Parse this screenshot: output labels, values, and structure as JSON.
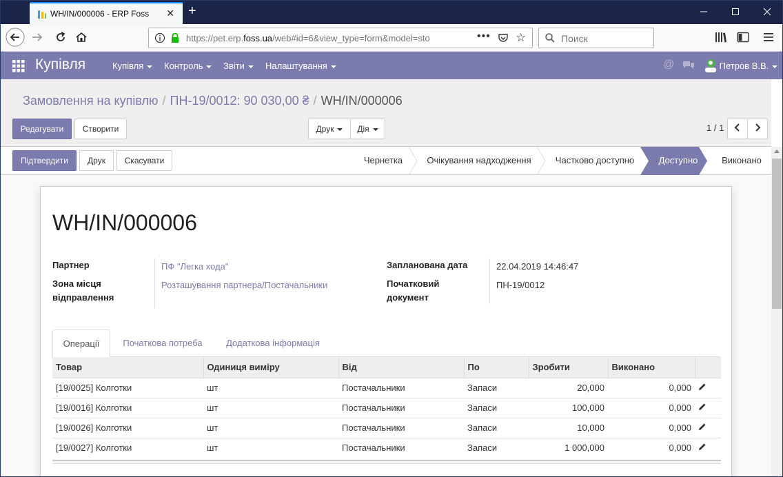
{
  "browser": {
    "tab_title": "WH/IN/000006 - ERP Foss",
    "url_prefix": "https://pet.erp.",
    "url_domain": "foss.ua",
    "url_suffix": "/web#id=6&view_type=form&model=sto",
    "search_placeholder": "Поиск"
  },
  "app": {
    "name": "Купівля",
    "menus": [
      "Купівля",
      "Контроль",
      "Звіти",
      "Налаштування"
    ],
    "user": "Петров В.В.",
    "accent_color": "#7c7bad"
  },
  "breadcrumb": [
    "Замовлення на купівлю",
    "ПН-19/0012: 90 030,00 ₴",
    "WH/IN/000006"
  ],
  "control": {
    "edit": "Редагувати",
    "create": "Створити",
    "print": "Друк",
    "action": "Дія",
    "pager": "1 / 1"
  },
  "statusbar": {
    "buttons": [
      "Підтвердити",
      "Друк",
      "Скасувати"
    ],
    "stages": [
      "Чернетка",
      "Очікування надходження",
      "Частково доступно",
      "Доступно",
      "Виконано"
    ],
    "active_stage": "Доступно"
  },
  "form": {
    "title": "WH/IN/000006",
    "partner_label": "Партнер",
    "partner_value": "ПФ \"Легка хода\"",
    "source_zone_label": "Зона місця відправлення",
    "source_zone_value": "Розташування партнера/Постачальники",
    "scheduled_date_label": "Запланована дата",
    "scheduled_date_value": "22.04.2019 14:46:47",
    "source_doc_label": "Початковий документ",
    "source_doc_value": "ПН-19/0012",
    "tabs": [
      "Операції",
      "Початкова потреба",
      "Додаткова інформація"
    ]
  },
  "table": {
    "columns": [
      "Товар",
      "Одиниця виміру",
      "Від",
      "По",
      "Зробити",
      "Виконано"
    ],
    "rows": [
      [
        "[19/0025] Колготки",
        "шт",
        "Постачальники",
        "Запаси",
        "20,000",
        "0,000"
      ],
      [
        "[19/0016] Колготки",
        "шт",
        "Постачальники",
        "Запаси",
        "100,000",
        "0,000"
      ],
      [
        "[19/0026] Колготки",
        "шт",
        "Постачальники",
        "Запаси",
        "10,000",
        "0,000"
      ],
      [
        "[19/0027] Колготки",
        "шт",
        "Постачальники",
        "Запаси",
        "1 000,000",
        "0,000"
      ]
    ]
  }
}
